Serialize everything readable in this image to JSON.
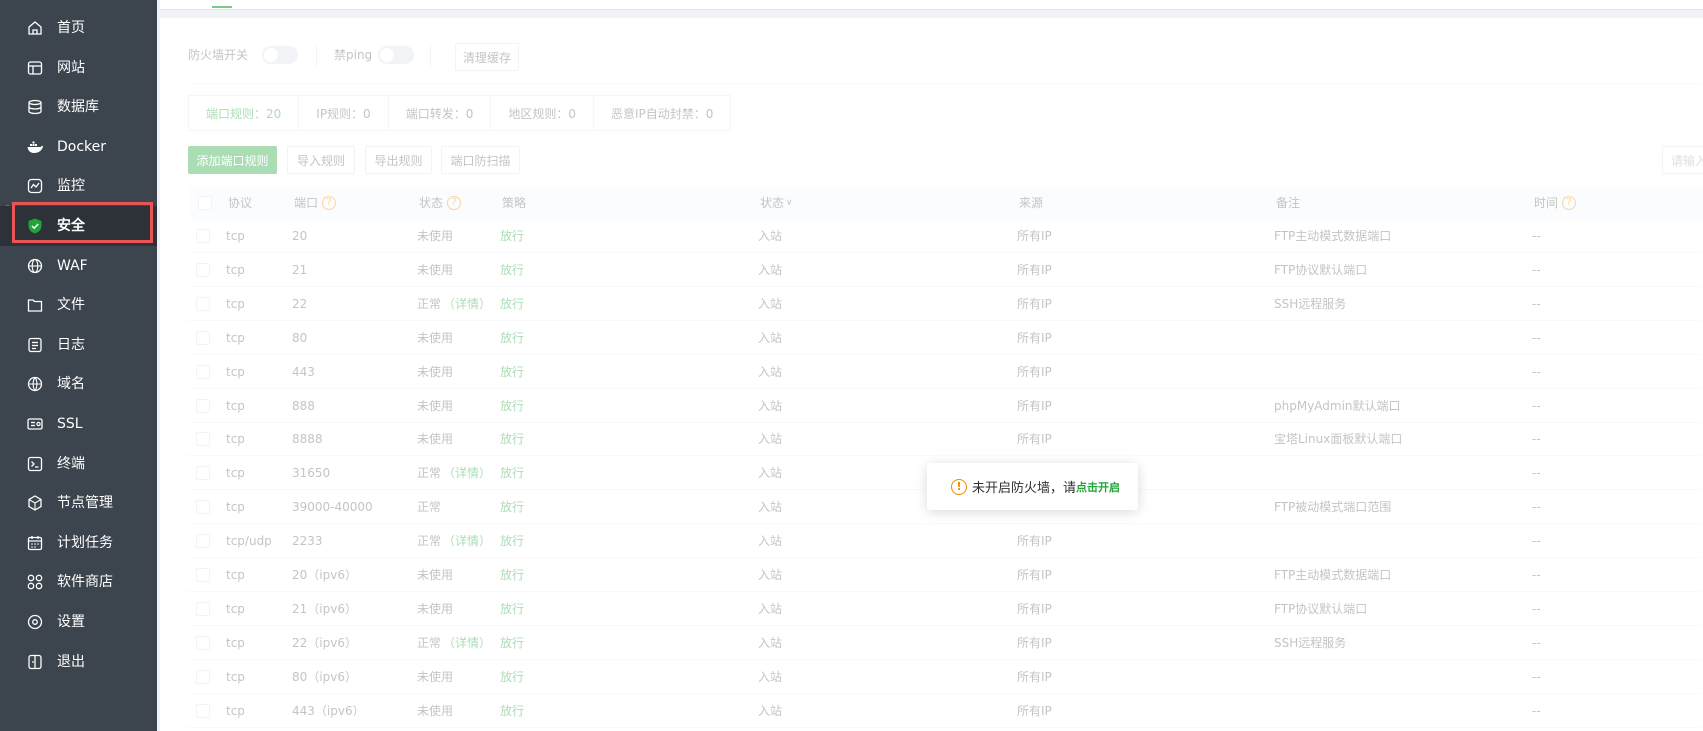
{
  "sidebar": {
    "items": [
      {
        "label": "首页",
        "icon": "home-icon"
      },
      {
        "label": "网站",
        "icon": "website-icon"
      },
      {
        "label": "数据库",
        "icon": "database-icon"
      },
      {
        "label": "Docker",
        "icon": "docker-icon"
      },
      {
        "label": "监控",
        "icon": "monitor-icon"
      },
      {
        "label": "安全",
        "icon": "shield-icon",
        "active": true
      },
      {
        "label": "WAF",
        "icon": "waf-icon"
      },
      {
        "label": "文件",
        "icon": "folder-icon"
      },
      {
        "label": "日志",
        "icon": "log-icon"
      },
      {
        "label": "域名",
        "icon": "globe-icon"
      },
      {
        "label": "SSL",
        "icon": "ssl-icon"
      },
      {
        "label": "终端",
        "icon": "terminal-icon"
      },
      {
        "label": "节点管理",
        "icon": "node-icon"
      },
      {
        "label": "计划任务",
        "icon": "calendar-icon"
      },
      {
        "label": "软件商店",
        "icon": "store-icon"
      },
      {
        "label": "设置",
        "icon": "settings-icon"
      },
      {
        "label": "退出",
        "icon": "logout-icon"
      }
    ]
  },
  "toolbar": {
    "firewall_switch_label": "防火墙开关",
    "ping_switch_label": "禁ping",
    "clear_cache_label": "清理缓存"
  },
  "tabs": [
    "端口规则：20",
    "IP规则：0",
    "端口转发：0",
    "地区规则：0",
    "恶意IP自动封禁：0"
  ],
  "actions": {
    "add_label": "添加端口规则",
    "import_label": "导入规则",
    "export_label": "导出规则",
    "scan_label": "端口防扫描",
    "search_placeholder": "请输入..."
  },
  "table": {
    "headers": {
      "protocol": "协议",
      "port": "端口",
      "status": "状态",
      "strategy": "策略",
      "direction": "状态",
      "source": "来源",
      "remark": "备注",
      "time": "时间"
    },
    "rows": [
      {
        "protocol": "tcp",
        "port": "20",
        "status": "未使用",
        "detail": "",
        "strategy": "放行",
        "direction": "入站",
        "source": "所有IP",
        "remark": "FTP主动模式数据端口",
        "time": "--"
      },
      {
        "protocol": "tcp",
        "port": "21",
        "status": "未使用",
        "detail": "",
        "strategy": "放行",
        "direction": "入站",
        "source": "所有IP",
        "remark": "FTP协议默认端口",
        "time": "--"
      },
      {
        "protocol": "tcp",
        "port": "22",
        "status": "正常",
        "detail": "（详情）",
        "strategy": "放行",
        "direction": "入站",
        "source": "所有IP",
        "remark": "SSH远程服务",
        "time": "--"
      },
      {
        "protocol": "tcp",
        "port": "80",
        "status": "未使用",
        "detail": "",
        "strategy": "放行",
        "direction": "入站",
        "source": "所有IP",
        "remark": "",
        "time": "--"
      },
      {
        "protocol": "tcp",
        "port": "443",
        "status": "未使用",
        "detail": "",
        "strategy": "放行",
        "direction": "入站",
        "source": "所有IP",
        "remark": "",
        "time": "--"
      },
      {
        "protocol": "tcp",
        "port": "888",
        "status": "未使用",
        "detail": "",
        "strategy": "放行",
        "direction": "入站",
        "source": "所有IP",
        "remark": "phpMyAdmin默认端口",
        "time": "--"
      },
      {
        "protocol": "tcp",
        "port": "8888",
        "status": "未使用",
        "detail": "",
        "strategy": "放行",
        "direction": "入站",
        "source": "所有IP",
        "remark": "宝塔Linux面板默认端口",
        "time": "--"
      },
      {
        "protocol": "tcp",
        "port": "31650",
        "status": "正常",
        "detail": "（详情）",
        "strategy": "放行",
        "direction": "入站",
        "source": "",
        "remark": "",
        "time": "--"
      },
      {
        "protocol": "tcp",
        "port": "39000-40000",
        "status": "正常",
        "detail": "",
        "strategy": "放行",
        "direction": "入站",
        "source": "",
        "remark": "FTP被动模式端口范围",
        "time": "--"
      },
      {
        "protocol": "tcp/udp",
        "port": "2233",
        "status": "正常",
        "detail": "（详情）",
        "strategy": "放行",
        "direction": "入站",
        "source": "所有IP",
        "remark": "",
        "time": "--"
      },
      {
        "protocol": "tcp",
        "port": "20（ipv6）",
        "status": "未使用",
        "detail": "",
        "strategy": "放行",
        "direction": "入站",
        "source": "所有IP",
        "remark": "FTP主动模式数据端口",
        "time": "--"
      },
      {
        "protocol": "tcp",
        "port": "21（ipv6）",
        "status": "未使用",
        "detail": "",
        "strategy": "放行",
        "direction": "入站",
        "source": "所有IP",
        "remark": "FTP协议默认端口",
        "time": "--"
      },
      {
        "protocol": "tcp",
        "port": "22（ipv6）",
        "status": "正常",
        "detail": "（详情）",
        "strategy": "放行",
        "direction": "入站",
        "source": "所有IP",
        "remark": "SSH远程服务",
        "time": "--"
      },
      {
        "protocol": "tcp",
        "port": "80（ipv6）",
        "status": "未使用",
        "detail": "",
        "strategy": "放行",
        "direction": "入站",
        "source": "所有IP",
        "remark": "",
        "time": "--"
      },
      {
        "protocol": "tcp",
        "port": "443（ipv6）",
        "status": "未使用",
        "detail": "",
        "strategy": "放行",
        "direction": "入站",
        "source": "所有IP",
        "remark": "",
        "time": "--"
      }
    ]
  },
  "toast": {
    "message": "未开启防火墙，请",
    "link": "点击开启"
  },
  "colors": {
    "sidebar_bg": "#3c444d",
    "accent": "#20a53a",
    "highlight": "#e95454",
    "warning": "#f08c00"
  }
}
